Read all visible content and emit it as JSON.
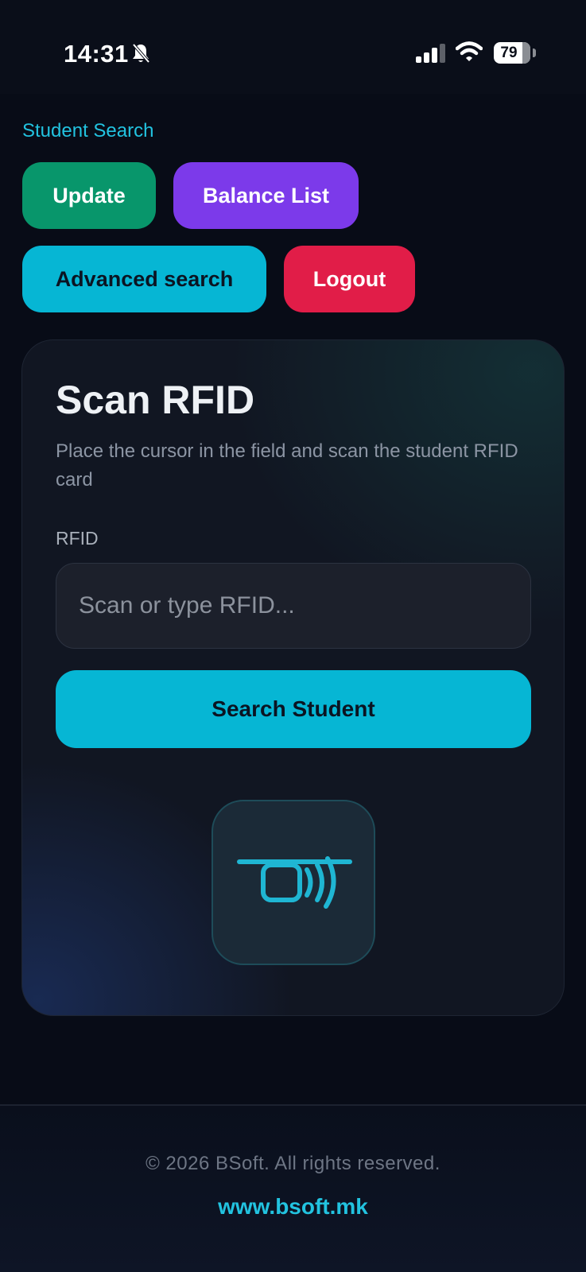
{
  "status_bar": {
    "time": "14:31",
    "battery_level": "79",
    "icons": [
      "bell-slash-icon",
      "signal-icon",
      "wifi-icon",
      "battery-icon"
    ]
  },
  "header": {
    "page_link": "Student Search"
  },
  "nav": {
    "update_label": "Update",
    "balance_label": "Balance List",
    "advanced_label": "Advanced search",
    "logout_label": "Logout"
  },
  "card": {
    "title": "Scan RFID",
    "description": "Place the cursor in the field and scan the student RFID card",
    "field_label": "RFID",
    "input_value": "",
    "input_placeholder": "Scan or type RFID...",
    "search_label": "Search Student",
    "icon": "rfid-scan-icon"
  },
  "footer": {
    "copyright": "© 2026 BSoft. All rights reserved.",
    "website": "www.bsoft.mk"
  },
  "colors": {
    "accent_cyan": "#06b6d4",
    "update_green": "#08966b",
    "balance_purple": "#7c3aea",
    "logout_red": "#e11d48",
    "background": "#080c17"
  }
}
